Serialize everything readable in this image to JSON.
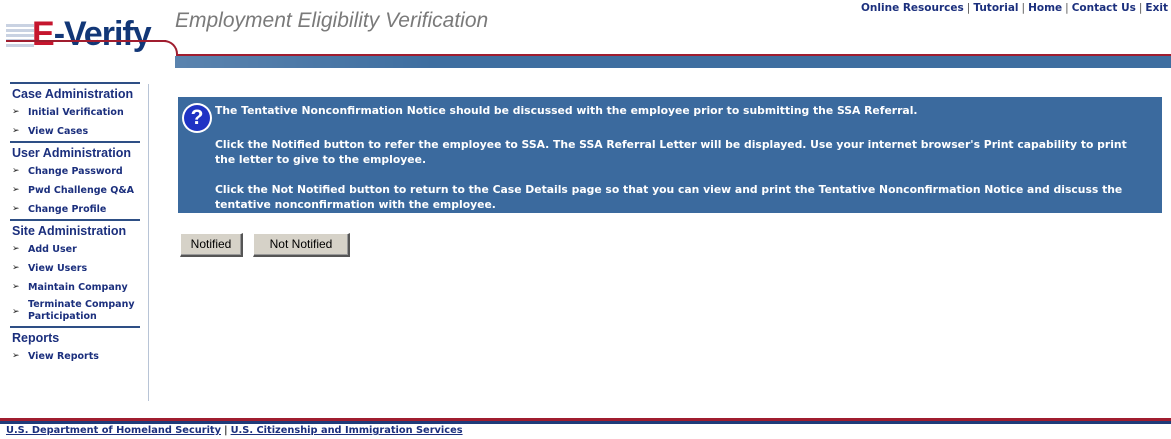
{
  "header": {
    "logo_e": "E",
    "logo_rest": "-Verify",
    "app_title": "Employment Eligibility Verification",
    "top_links": [
      "Online Resources",
      "Tutorial",
      "Home",
      "Contact Us",
      "Exit"
    ]
  },
  "sidebar": {
    "sections": [
      {
        "heading": "Case Administration",
        "items": [
          "Initial Verification",
          "View Cases"
        ]
      },
      {
        "heading": "User Administration",
        "items": [
          "Change Password",
          "Pwd Challenge Q&A",
          "Change Profile"
        ]
      },
      {
        "heading": "Site Administration",
        "items": [
          "Add User",
          "View Users",
          "Maintain Company",
          "Terminate Company Participation"
        ]
      },
      {
        "heading": "Reports",
        "items": [
          "View Reports"
        ]
      }
    ]
  },
  "info": {
    "icon": "help-icon",
    "line1": "The Tentative Nonconfirmation Notice should be discussed with the employee prior to submitting the SSA Referral.",
    "line2": "Click the Notified button to refer the employee to SSA. The SSA Referral Letter will be displayed. Use your internet browser's Print capability to print the letter to give to the employee.",
    "line3": "Click the Not Notified button to return to the Case Details page so that you can view and print the Tentative Nonconfirmation Notice and discuss the tentative nonconfirmation with the employee."
  },
  "buttons": {
    "notified": "Notified",
    "not_notified": "Not Notified"
  },
  "footer": {
    "links": [
      "U.S. Department of Homeland Security",
      "U.S. Citizenship and Immigration Services"
    ]
  },
  "colors": {
    "brand_red": "#c5162e",
    "brand_blue": "#123777",
    "panel_blue": "#3b6a9e",
    "link_blue": "#1b2f7d"
  }
}
